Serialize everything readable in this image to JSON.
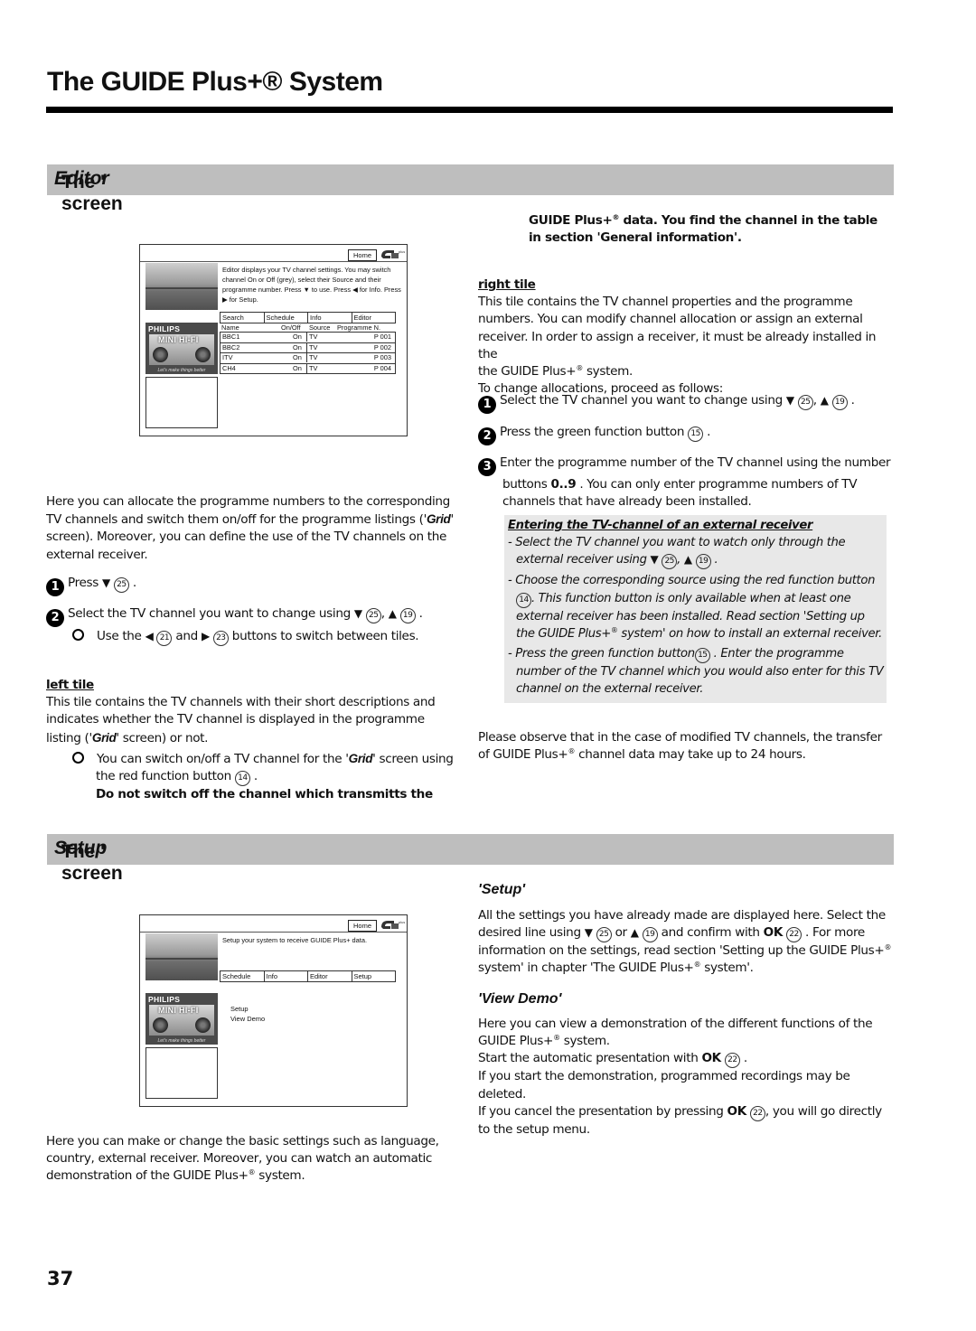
{
  "page": {
    "title": "The GUIDE Plus+® System",
    "page_number": "37"
  },
  "editor_section": {
    "heading_prefix": "The '",
    "heading_italic": "Editor",
    "heading_suffix": "' screen",
    "tv_screen": {
      "home_label": "Home",
      "logo_icon": "guide-plus-logo",
      "description": "Editor displays your TV channel settings. You may switch channel On or Off (grey), select their Source and their programme number. Press ▼ to use. Press ◀ for Info. Press ▶ for Setup.",
      "tabs": [
        "Search",
        "Schedule",
        "Info",
        "Editor"
      ],
      "columns": [
        "Name",
        "On/Off",
        "Source",
        "Programme N."
      ],
      "rows": [
        {
          "name": "BBC1",
          "onoff": "On",
          "source": "TV",
          "prog": "P 001"
        },
        {
          "name": "BBC2",
          "onoff": "On",
          "source": "TV",
          "prog": "P 002"
        },
        {
          "name": "ITV",
          "onoff": "On",
          "source": "TV",
          "prog": "P 003"
        },
        {
          "name": "CH4",
          "onoff": "On",
          "source": "TV",
          "prog": "P 004"
        }
      ],
      "ad_brand": "PHILIPS",
      "ad_product": "MINI HI-FI",
      "ad_tagline": "Let's make things better"
    },
    "intro": {
      "text_before": "Here you can allocate the programme numbers to the corresponding TV channels and switch them on/off for the programme listings ('",
      "grid_word": "Grid",
      "text_after": "' screen). Moreover, you can define the use of the TV channels on the external receiver."
    },
    "steps": [
      {
        "num": "1",
        "text": "Press",
        "tail": "."
      },
      {
        "num": "2",
        "text": "Select the TV channel you want to change using",
        "sep": ",",
        "tail": "."
      }
    ],
    "sub_bullet": {
      "before": "Use the",
      "middle": "and",
      "after": "buttons to switch between tiles."
    },
    "left_tile": {
      "heading": "left tile",
      "text_before": "This tile contains the TV channels with their short descriptions and indicates whether the TV channel is displayed in the programme listing ('",
      "grid_word": "Grid",
      "text_after": "' screen) or not.",
      "bullet_before": "You can switch on/off a TV channel for the '",
      "bullet_grid": "Grid",
      "bullet_after": "' screen using the red function button",
      "bullet_end": ".",
      "warning_line1": "Do not switch off the channel which transmitts the",
      "warning_line2_a": "GUIDE Plus+",
      "warning_line2_b": " data. You find the channel in the table",
      "warning_line3": "in section 'General information'."
    },
    "right_tile": {
      "heading": "right tile",
      "text": "This tile contains the TV channel properties and the programme numbers. You can modify channel allocation or assign an external receiver. In order to assign a receiver, it must be already installed in the",
      "text_sys_a": "the GUIDE Plus+",
      "text_sys_b": " system.",
      "proceed": "To change allocations, proceed as follows:",
      "steps": [
        {
          "num": "1",
          "text": "Select the TV channel you want to change using",
          "sep": ",",
          "tail": "."
        },
        {
          "num": "2",
          "text": "Press the green function button",
          "tail": "."
        },
        {
          "num": "3",
          "text_a": "Enter the programme number of the TV channel using the number buttons",
          "keys": "0..9",
          "text_b": ". You can only enter programme numbers of TV channels that have already been installed."
        }
      ]
    },
    "note_box": {
      "heading": "Entering the TV-channel of an external receiver",
      "item1_a": "- Select the TV channel you want to watch only through the external receiver using",
      "item1_sep": ",",
      "item1_end": ".",
      "item2_a": "- Choose the corresponding source using the red function button",
      "item2_b": ". This function button is only available when at least one external receiver has been installed. Read section 'Setting up the GUIDE Plus+",
      "item2_c": " system' on how to install an external receiver.",
      "item3_a": "- Press the green function button",
      "item3_b": ". Enter the programme number of the TV channel which you would also enter for this TV channel on the external receiver."
    },
    "observe": {
      "text_a": "Please observe that in the case of modified TV channels, the transfer of GUIDE Plus+",
      "text_b": " channel data may take up to 24 hours."
    }
  },
  "setup_section": {
    "heading_prefix": "The '",
    "heading_italic": "Setup",
    "heading_suffix": "' screen",
    "tv_screen": {
      "home_label": "Home",
      "description": "Setup your system to receive GUIDE Plus+ data.",
      "tabs": [
        "Schedule",
        "Info",
        "Editor",
        "Setup"
      ],
      "menu_items": [
        "Setup",
        "View Demo"
      ],
      "ad_brand": "PHILIPS",
      "ad_product": "MINI HI-FI",
      "ad_tagline": "Let's make things better"
    },
    "intro": {
      "text_a": "Here you can make or change the basic settings such as language, country, external receiver. Moreover, you can watch an automatic demonstration of the GUIDE Plus+",
      "text_b": " system."
    },
    "setup_item": {
      "heading": "Setup",
      "text_a": "All the settings you have already made are displayed here. Select the desired line using",
      "or": "or",
      "text_b": "and confirm with",
      "ok": "OK",
      "text_c": ". For more information on the settings, read section 'Setting up the GUIDE Plus+",
      "text_d": " system' in chapter 'The GUIDE Plus+",
      "text_e": " system'."
    },
    "view_demo": {
      "heading": "View Demo",
      "line1_a": "Here you can view a demonstration of the different functions of the GUIDE Plus+",
      "line1_b": " system.",
      "line2": "Start the automatic presentation with",
      "line3": "If you start the demonstration, programmed recordings may be deleted.",
      "line4_a": "If you cancel the presentation by pressing",
      "line4_b": ", you will go directly to the setup menu.",
      "ok": "OK"
    }
  },
  "buttons": {
    "down": "25",
    "up": "19",
    "left": "21",
    "right": "23",
    "ok": "22",
    "red": "14",
    "green": "15",
    "down_glyph": "▼",
    "up_glyph": "▲",
    "left_glyph": "◀",
    "right_glyph": "▶",
    "registered": "®"
  }
}
